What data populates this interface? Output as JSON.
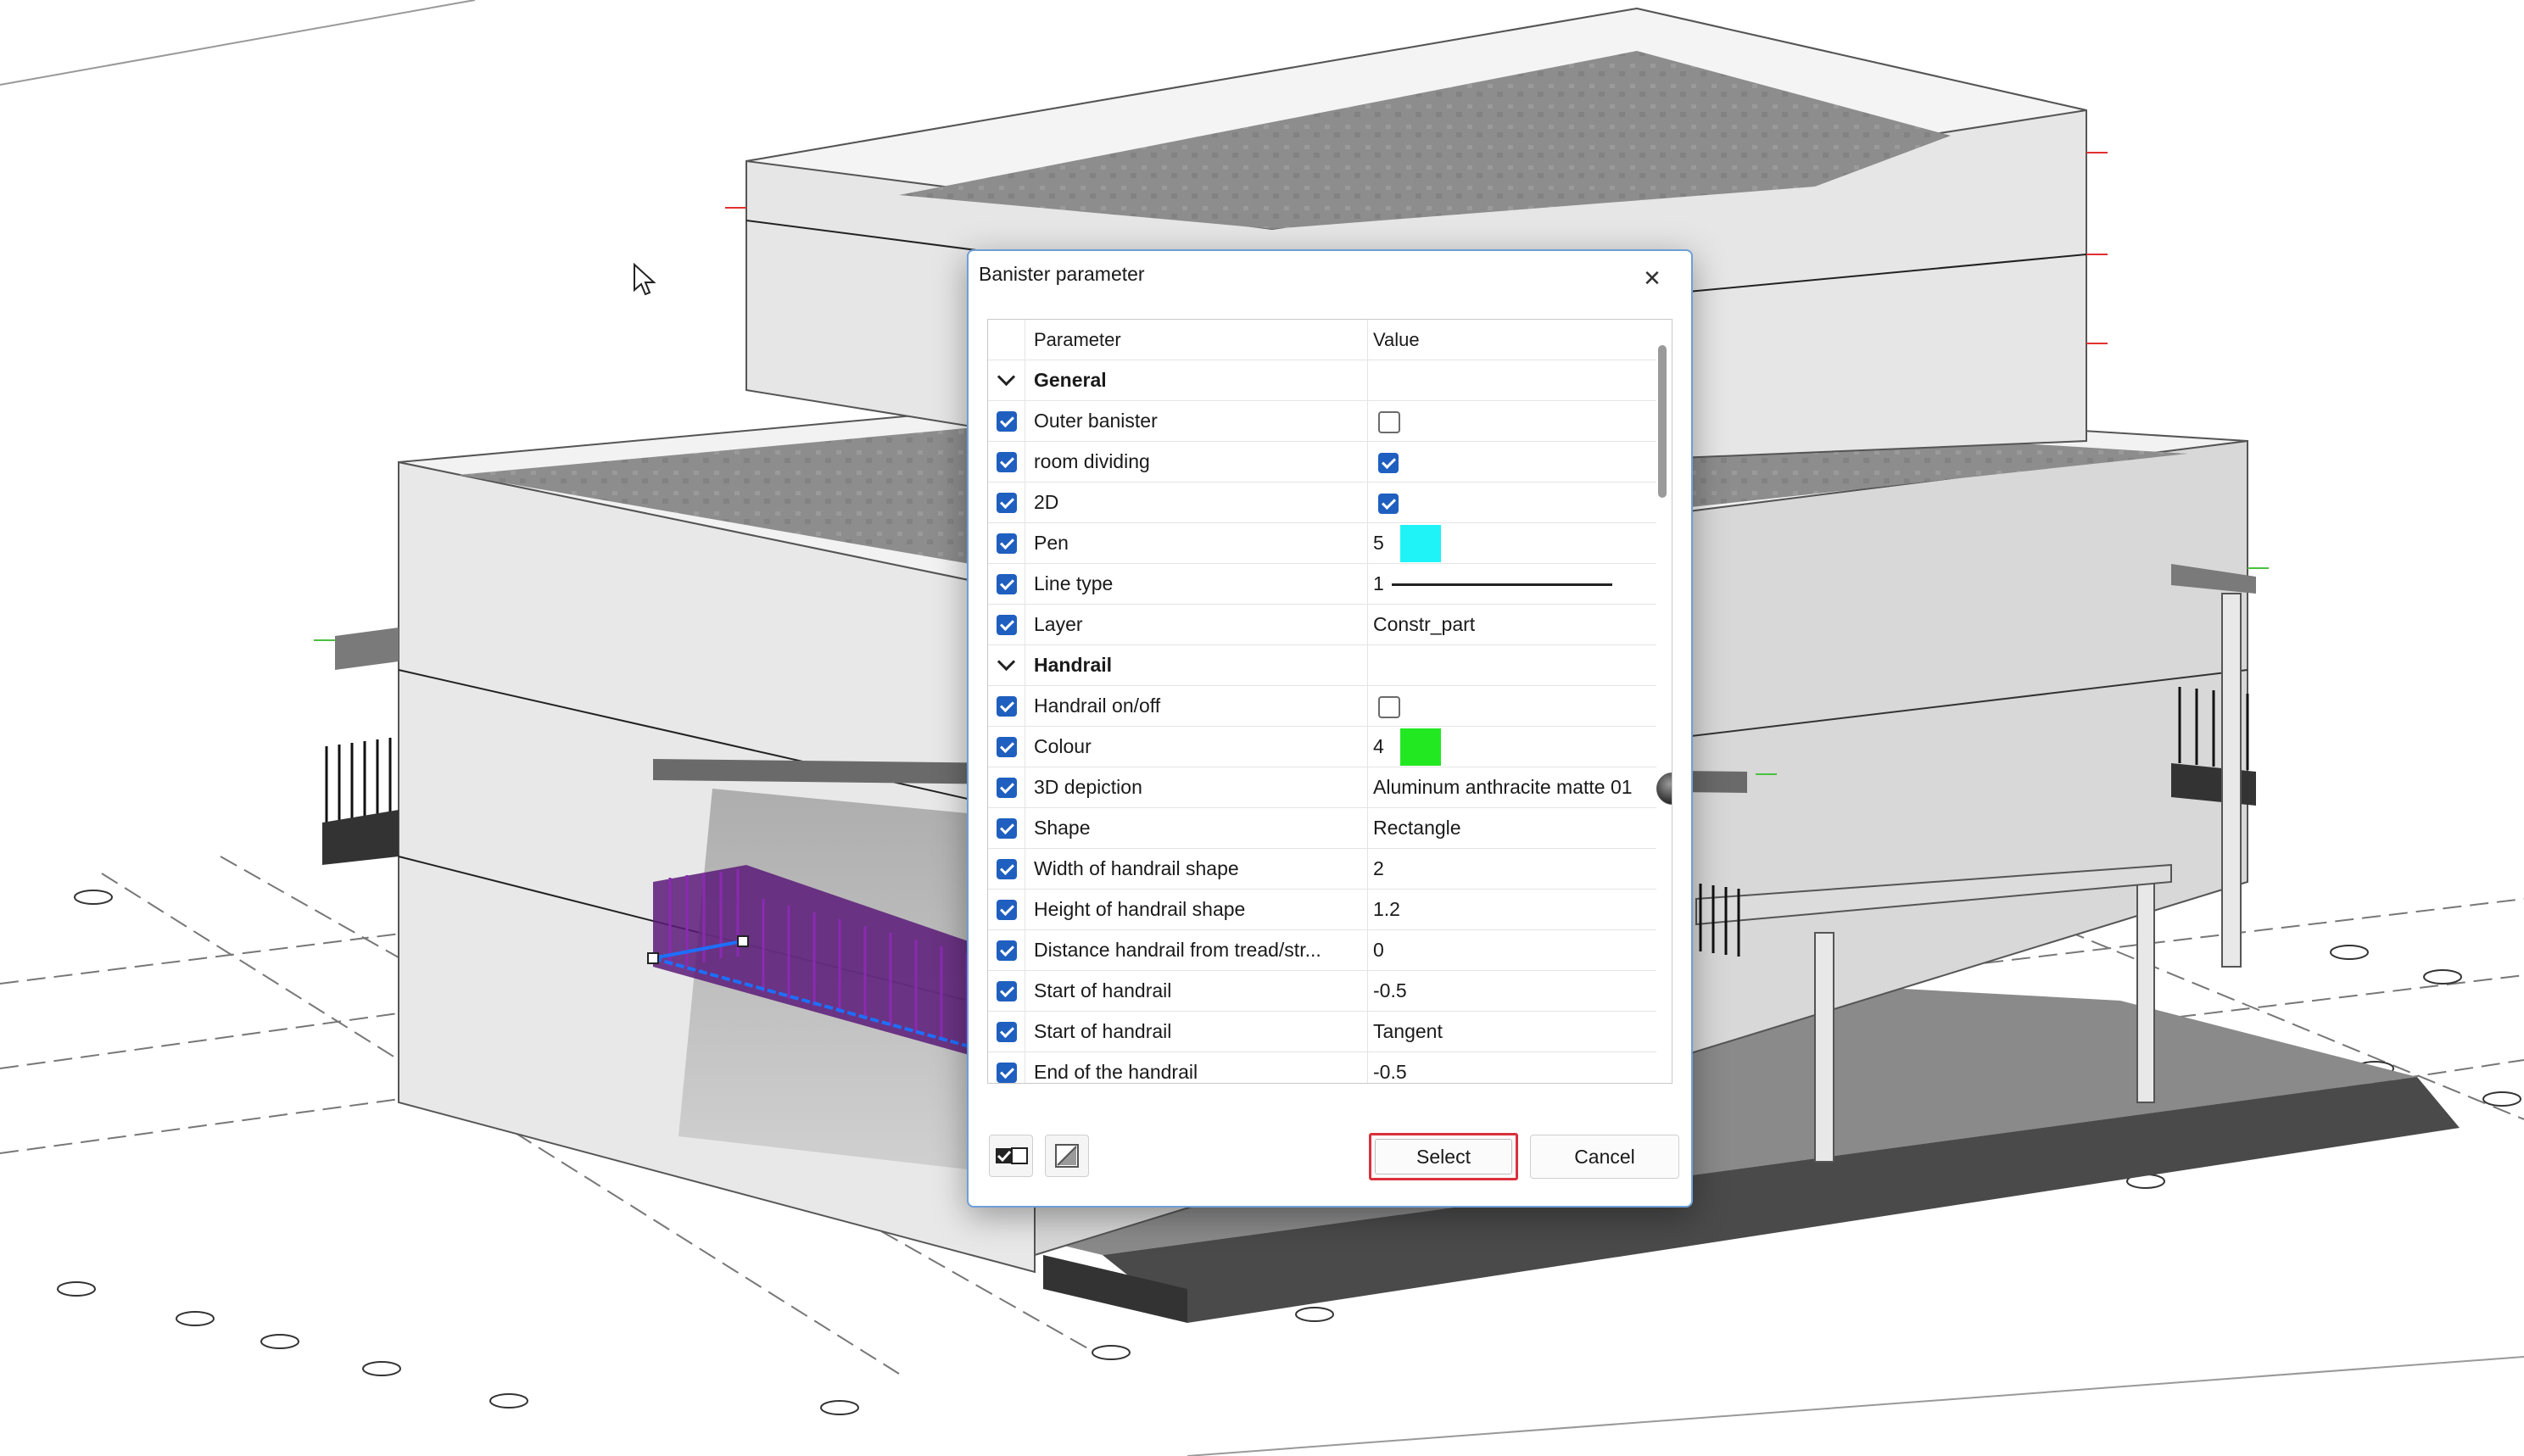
{
  "dialog": {
    "title": "Banister parameter",
    "help_glyph": "?",
    "close_glyph": "✕"
  },
  "grid": {
    "header": {
      "parameter": "Parameter",
      "value": "Value"
    },
    "groups": [
      {
        "title": "General",
        "rows": [
          {
            "name": "Outer banister",
            "value_type": "checkbox",
            "checked": false
          },
          {
            "name": "room dividing",
            "value_type": "checkbox",
            "checked": true
          },
          {
            "name": "2D",
            "value_type": "checkbox",
            "checked": true
          },
          {
            "name": "Pen",
            "value": "5",
            "swatch": "#1ff3f8"
          },
          {
            "name": "Line type",
            "value": "1"
          },
          {
            "name": "Layer",
            "value": "Constr_part"
          }
        ]
      },
      {
        "title": "Handrail",
        "rows": [
          {
            "name": "Handrail on/off",
            "value_type": "checkbox",
            "checked": false
          },
          {
            "name": "Colour",
            "value": "4",
            "swatch": "#22e822"
          },
          {
            "name": "3D depiction",
            "value": "Aluminum anthracite matte 01",
            "icon": "material-sphere-icon"
          },
          {
            "name": "Shape",
            "value": "Rectangle"
          },
          {
            "name": "Width of handrail shape",
            "value": "2"
          },
          {
            "name": "Height of handrail shape",
            "value": "1.2"
          },
          {
            "name": "Distance handrail from tread/str...",
            "value": "0"
          },
          {
            "name": "Start of handrail",
            "value": "-0.5"
          },
          {
            "name": "Start of handrail",
            "value": "Tangent"
          },
          {
            "name": "End of the handrail",
            "value": "-0.5"
          }
        ]
      }
    ]
  },
  "footer": {
    "select_label": "Select",
    "cancel_label": "Cancel"
  },
  "colors": {
    "accent": "#1f5fbf",
    "highlight_border": "#d9313b",
    "banister_purple": "#5a1a78"
  }
}
